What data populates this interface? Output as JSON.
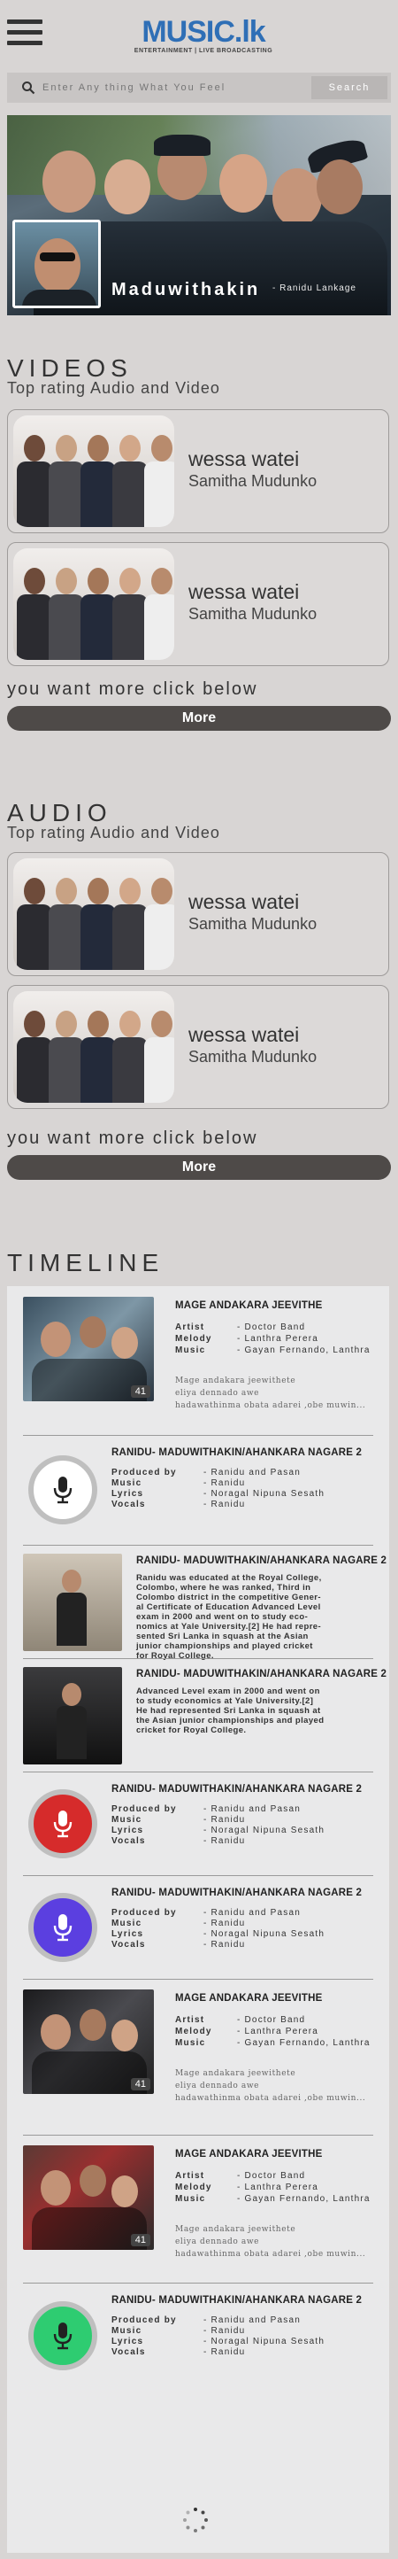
{
  "header": {
    "logo_main": "MUSIC.lk",
    "logo_tagline": "ENTERTAINMENT | LIVE BROADCASTING",
    "search_placeholder": "Enter Any thing What You Feel",
    "search_button": "Search"
  },
  "hero": {
    "title": "Maduwithakin",
    "subtitle": "- Ranidu Lankage"
  },
  "videos": {
    "title": "VIDEOS",
    "subtitle": "Top rating Audio and Video",
    "items": [
      {
        "title": "wessa watei",
        "artist": "Samitha Mudunko"
      },
      {
        "title": "wessa watei",
        "artist": "Samitha Mudunko"
      }
    ],
    "more_text": "you want more click below",
    "more_button": "More"
  },
  "audio": {
    "title": "AUDIO",
    "subtitle": "Top rating Audio and Video",
    "items": [
      {
        "title": "wessa watei",
        "artist": "Samitha Mudunko"
      },
      {
        "title": "wessa watei",
        "artist": "Samitha Mudunko"
      }
    ],
    "more_text": "you want more click below",
    "more_button": "More"
  },
  "timeline": {
    "title": "TIMELINE",
    "items": [
      {
        "type": "photo",
        "badge": "41",
        "title": "MAGE ANDAKARA JEEVITHE",
        "fields": [
          [
            "Artist",
            "- Doctor Band"
          ],
          [
            "Melody",
            "- Lanthra Perera"
          ],
          [
            "Music",
            "- Gayan Fernando, Lanthra"
          ]
        ],
        "desc1": "Mage andakara jeewithete",
        "desc2": "eliya dennado awe",
        "desc3": "hadawathinma obata adarei ,obe muwin..."
      },
      {
        "type": "mic",
        "mic_color": "#ffffff",
        "mic_icon_color": "#222222",
        "title": "RANIDU- MADUWITHAKIN/AHANKARA NAGARE 2",
        "fields": [
          [
            "Produced by",
            "- Ranidu and Pasan"
          ],
          [
            "Music",
            "- Ranidu"
          ],
          [
            "Lyrics",
            "- Noragal Nipuna Sesath"
          ],
          [
            "Vocals",
            "- Ranidu"
          ]
        ]
      },
      {
        "type": "para",
        "title": "RANIDU- MADUWITHAKIN/AHANKARA NAGARE 2",
        "para": [
          "Ranidu was educated at the Royal College,",
          "Colombo, where he was ranked, Third in",
          "Colombo district in the competitive Gener-",
          "al Certificate of Education Advanced Level",
          "exam in 2000 and went on to study eco-",
          "nomics at Yale University.[2] He had repre-",
          "sented Sri Lanka in squash at the Asian",
          "junior championships and played cricket",
          "for Royal College."
        ]
      },
      {
        "type": "para",
        "title": "RANIDU- MADUWITHAKIN/AHANKARA NAGARE 2",
        "para": [
          "Advanced Level exam in 2000 and went on",
          "to study economics at Yale University.[2]",
          "He had represented Sri Lanka in squash at",
          "the Asian junior championships and played",
          "cricket for Royal College."
        ]
      },
      {
        "type": "mic",
        "mic_color": "#d62b2b",
        "mic_icon_color": "#ffffff",
        "title": "RANIDU- MADUWITHAKIN/AHANKARA NAGARE 2",
        "fields": [
          [
            "Produced by",
            "- Ranidu and Pasan"
          ],
          [
            "Music",
            "- Ranidu"
          ],
          [
            "Lyrics",
            "- Noragal Nipuna Sesath"
          ],
          [
            "Vocals",
            "- Ranidu"
          ]
        ]
      },
      {
        "type": "mic",
        "mic_color": "#5b3fe0",
        "mic_icon_color": "#ffffff",
        "title": "RANIDU- MADUWITHAKIN/AHANKARA NAGARE 2",
        "fields": [
          [
            "Produced by",
            "- Ranidu and Pasan"
          ],
          [
            "Music",
            "- Ranidu"
          ],
          [
            "Lyrics",
            "- Noragal Nipuna Sesath"
          ],
          [
            "Vocals",
            "- Ranidu"
          ]
        ]
      },
      {
        "type": "photo",
        "badge": "41",
        "title": "MAGE ANDAKARA JEEVITHE",
        "fields": [
          [
            "Artist",
            "- Doctor Band"
          ],
          [
            "Melody",
            "- Lanthra Perera"
          ],
          [
            "Music",
            "- Gayan Fernando, Lanthra"
          ]
        ],
        "desc1": "Mage andakara jeewithete",
        "desc2": "eliya dennado awe",
        "desc3": "hadawathinma obata adarei ,obe muwin..."
      },
      {
        "type": "photo",
        "badge": "41",
        "title": "MAGE ANDAKARA JEEVITHE",
        "fields": [
          [
            "Artist",
            "- Doctor Band"
          ],
          [
            "Melody",
            "- Lanthra Perera"
          ],
          [
            "Music",
            "- Gayan Fernando, Lanthra"
          ]
        ],
        "desc1": "Mage andakara jeewithete",
        "desc2": "eliya dennado awe",
        "desc3": "hadawathinma obata adarei ,obe muwin..."
      },
      {
        "type": "mic",
        "mic_color": "#2ecc71",
        "mic_icon_color": "#222222",
        "title": "RANIDU- MADUWITHAKIN/AHANKARA NAGARE 2",
        "fields": [
          [
            "Produced by",
            "- Ranidu and Pasan"
          ],
          [
            "Music",
            "- Ranidu"
          ],
          [
            "Lyrics",
            "- Noragal Nipuna Sesath"
          ],
          [
            "Vocals",
            "- Ranidu"
          ]
        ]
      }
    ]
  },
  "colors": {
    "accent_dark": "#4e4a48",
    "logo_blue": "#2f6fb6",
    "background": "#d8d5d4"
  }
}
